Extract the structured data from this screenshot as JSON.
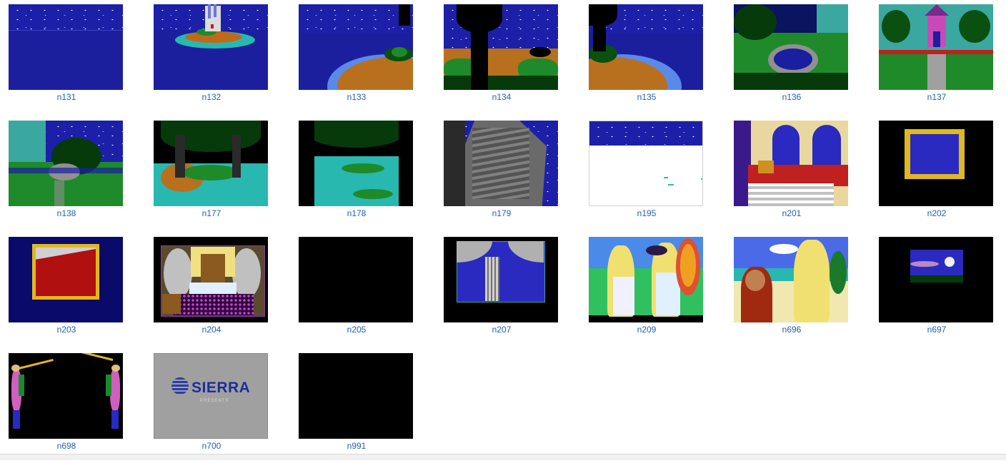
{
  "folder": {
    "view": "large-icons",
    "items": [
      {
        "name": "n131",
        "scene": "night-sea"
      },
      {
        "name": "n132",
        "scene": "island-castle"
      },
      {
        "name": "n133",
        "scene": "shore-palm"
      },
      {
        "name": "n134",
        "scene": "palm-beach"
      },
      {
        "name": "n135",
        "scene": "shore-palm-left"
      },
      {
        "name": "n136",
        "scene": "garden-pond"
      },
      {
        "name": "n137",
        "scene": "castle-garden"
      },
      {
        "name": "n138",
        "scene": "garden-statue"
      },
      {
        "name": "n177",
        "scene": "swamp-trees"
      },
      {
        "name": "n178",
        "scene": "swamp-lagoon"
      },
      {
        "name": "n179",
        "scene": "rock-cliff"
      },
      {
        "name": "n195",
        "scene": "white-ground"
      },
      {
        "name": "n201",
        "scene": "throne-room"
      },
      {
        "name": "n202",
        "scene": "gold-frame"
      },
      {
        "name": "n203",
        "scene": "red-frame"
      },
      {
        "name": "n204",
        "scene": "bedroom"
      },
      {
        "name": "n205",
        "scene": "black"
      },
      {
        "name": "n207",
        "scene": "arches"
      },
      {
        "name": "n209",
        "scene": "fairy-meeting"
      },
      {
        "name": "n696",
        "scene": "beach-couple"
      },
      {
        "name": "n697",
        "scene": "moon-window"
      },
      {
        "name": "n698",
        "scene": "trumpeters"
      },
      {
        "name": "n700",
        "scene": "sierra-presents"
      },
      {
        "name": "n991",
        "scene": "black"
      }
    ]
  },
  "sierra": {
    "logo_text": "SIERRA",
    "sub_text": "PRESENTS"
  },
  "colors": {
    "label": "#1f5fb4",
    "night_sky": "#1c20a8",
    "grass": "#1f8a2a",
    "sand": "#b8701e"
  }
}
